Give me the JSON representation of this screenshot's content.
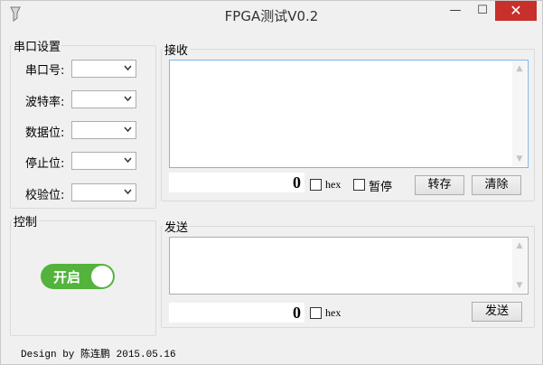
{
  "window": {
    "title": "FPGA测试V0.2",
    "minimize_glyph": "—",
    "maximize_glyph": "☐",
    "close_glyph": "✕",
    "close_color": "#c7302b"
  },
  "serial": {
    "legend": "串口设置",
    "fields": [
      {
        "label": "串口号:",
        "value": ""
      },
      {
        "label": "波特率:",
        "value": ""
      },
      {
        "label": "数据位:",
        "value": ""
      },
      {
        "label": "停止位:",
        "value": ""
      },
      {
        "label": "校验位:",
        "value": ""
      }
    ]
  },
  "control": {
    "legend": "控制",
    "toggle_label": "开启",
    "toggle_on": true,
    "toggle_color": "#53b33c"
  },
  "receive": {
    "legend": "接收",
    "text": "",
    "count": "0",
    "hex_label": "hex",
    "hex_checked": false,
    "pause_label": "暂停",
    "pause_checked": false,
    "save_label": "转存",
    "clear_label": "清除"
  },
  "send": {
    "legend": "发送",
    "text": "",
    "count": "0",
    "hex_label": "hex",
    "hex_checked": false,
    "send_label": "发送"
  },
  "footer": {
    "text": "Design by 陈连鹏 2015.05.16"
  }
}
